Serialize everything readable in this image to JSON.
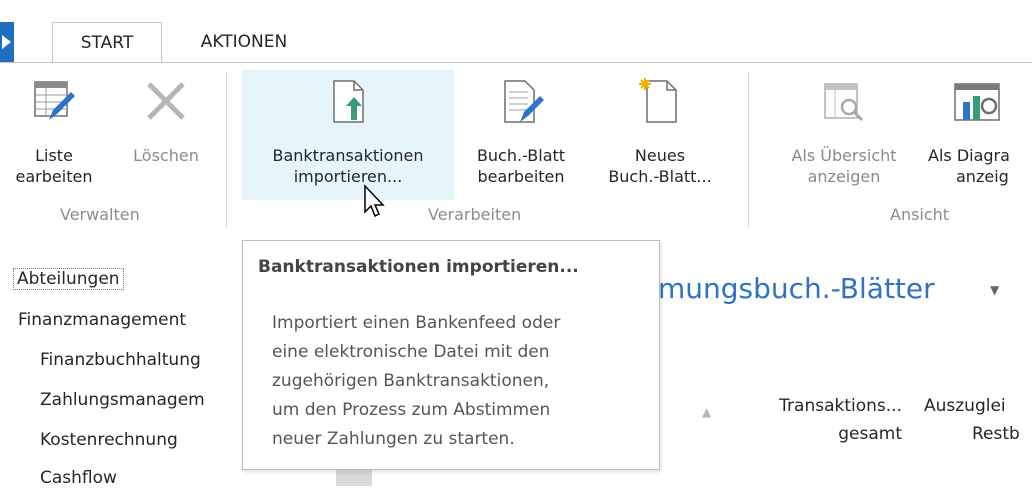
{
  "tabs": [
    {
      "label": "START",
      "active": true
    },
    {
      "label": "AKTIONEN",
      "active": false
    }
  ],
  "ribbon": {
    "buttons": [
      {
        "line1": "Liste",
        "line2": "earbeiten",
        "icon": "edit-list-icon",
        "enabled": true
      },
      {
        "line1": "Löschen",
        "line2": "",
        "icon": "delete-x-icon",
        "enabled": false
      },
      {
        "line1": "Banktransaktionen",
        "line2": "importieren...",
        "icon": "import-document-icon",
        "enabled": true
      },
      {
        "line1": "Buch.-Blatt",
        "line2": "bearbeiten",
        "icon": "edit-journal-icon",
        "enabled": true
      },
      {
        "line1": "Neues",
        "line2": "Buch.-Blatt...",
        "icon": "new-document-icon",
        "enabled": true
      },
      {
        "line1": "Als Übersicht",
        "line2": "anzeigen",
        "icon": "show-as-list-icon",
        "enabled": false
      },
      {
        "line1": "Als Diagra",
        "line2": "anzeig",
        "icon": "show-as-chart-icon",
        "enabled": true
      }
    ],
    "groups": [
      "Verwalten",
      "Verarbeiten",
      "Ansicht"
    ]
  },
  "nav": {
    "items": [
      "Abteilungen",
      "Finanzmanagement",
      "Finanzbuchhaltung",
      "Zahlungsmanagem",
      "Kostenrechnung",
      "Cashflow"
    ]
  },
  "content": {
    "title": "mungsbuch.-Blätter",
    "columns": [
      {
        "line1": "Transaktions...",
        "line2": "gesamt"
      },
      {
        "line1": "Auszuglei",
        "line2": "Restb"
      }
    ]
  },
  "tooltip": {
    "title": "Banktransaktionen importieren...",
    "lines": [
      "Importiert einen Bankenfeed oder",
      "eine elektronische Datei mit den",
      "zugehörigen Banktransaktionen,",
      "um den Prozess zum Abstimmen",
      "neuer Zahlungen zu starten."
    ]
  },
  "colors": {
    "accent": "#1f6ec5",
    "title": "#2f73c8",
    "hover": "#e6f5fb"
  }
}
